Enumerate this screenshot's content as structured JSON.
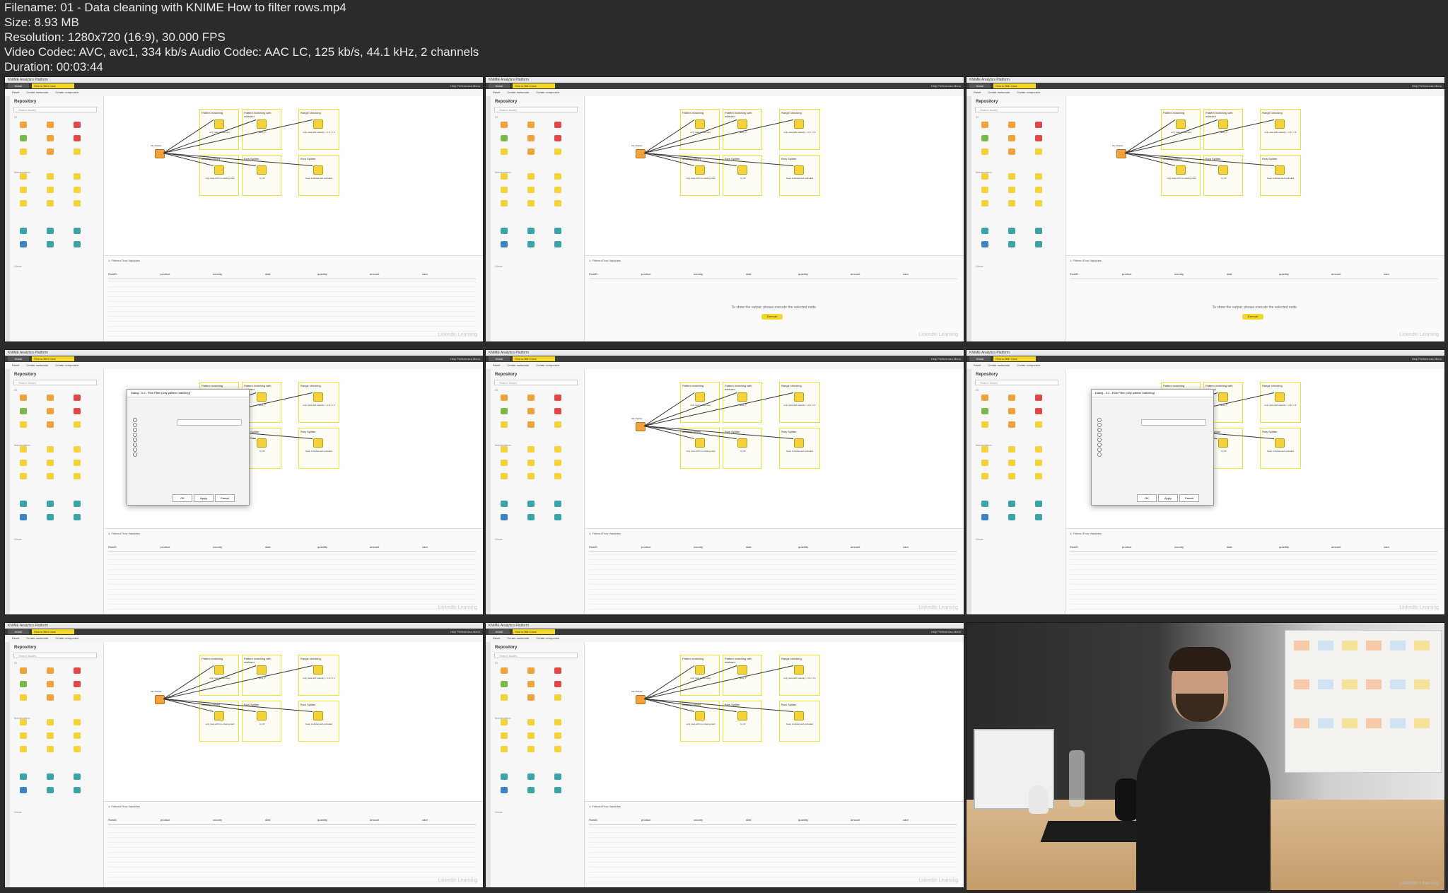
{
  "file_info": {
    "filename": "Filename: 01 - Data cleaning with KNIME How to filter rows.mp4",
    "size": "Size: 8.93 MB",
    "resolution": "Resolution: 1280x720 (16:9), 30.000 FPS",
    "codec": "Video Codec: AVC, avc1, 334 kb/s Audio Codec: AAC LC, 125 kb/s, 44.1 kHz, 2 channels",
    "duration": "Duration: 00:03:44"
  },
  "app": {
    "window_title": "KNIME Analytics Platform",
    "home_tab": "Home",
    "workflow_tab": "How to filter rows",
    "right_menu": "Help   Preferences   Menu",
    "toolbar": [
      "Reset",
      "Create metanode",
      "Create component"
    ],
    "repository_title": "Repository",
    "search_placeholder": "Search Nodes",
    "section_io": "IO",
    "section_manipulation": "Manipulation",
    "section_views": "Views",
    "output_tabs": "1: Filtered      Flow Variables",
    "empty_output_message": "To show the output, please execute the selected node.",
    "execute_label": "Execute",
    "dialog_title": "Dialog - 0:2 - Row Filter (only pattern matching)",
    "dialog_buttons": [
      "OK",
      "Apply",
      "Cancel"
    ],
    "watermark": "LinkedIn Learning",
    "colors": {
      "accent": "#f5d728",
      "box_border": "#f0e42f",
      "reader_node": "#f0a33c",
      "filter_node": "#f3d23a",
      "background": "#2b2b2b"
    }
  },
  "workflow_boxes": [
    {
      "title": "Pattern matching",
      "node": "Row Filter",
      "caption": "only rows in Germany"
    },
    {
      "title": "Pattern matching with wildcard",
      "node": "Row Filter",
      "caption": "prod_1*"
    },
    {
      "title": "Range checking",
      "node": "Row Filter",
      "caption": "only rows with quantity > 2 & <= 6"
    },
    {
      "title": "Missing values",
      "node": "Row Filter",
      "caption": "only rows with no missing card"
    },
    {
      "title": "Row Splitter",
      "node": "Row Splitter",
      "caption": "by ID"
    },
    {
      "title": "Row Splitter",
      "node": "Row Splitter",
      "caption": "Keep included and excluded"
    }
  ],
  "reader_node": {
    "name": "File Reader",
    "caption": "sales records"
  },
  "table_columns": [
    "RowID",
    "product",
    "country",
    "date",
    "quantity",
    "amount",
    "card"
  ]
}
